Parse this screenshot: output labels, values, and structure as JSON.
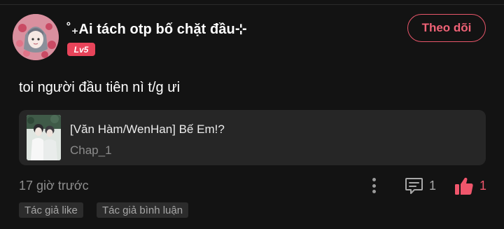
{
  "comment": {
    "author": {
      "name": "˚₊Ai tách otp bố chặt đầu⊹",
      "level": "Lv5",
      "avatar_icon": "avatar-image"
    },
    "follow_label": "Theo dõi",
    "text": "toi người đầu tiên nì t/g ưi",
    "story": {
      "title": "[Văn Hàm/WenHan] Bế Em!?",
      "chapter": "Chap_1",
      "thumbnail_icon": "story-cover-image"
    },
    "time": "17 giờ trước",
    "reply_count": "1",
    "like_count": "1",
    "tags": [
      "Tác giả like",
      "Tác giả bình luận"
    ]
  },
  "colors": {
    "background": "#131313",
    "card": "#262626",
    "accent": "#e8445a",
    "muted_text": "#8e8e8e"
  }
}
